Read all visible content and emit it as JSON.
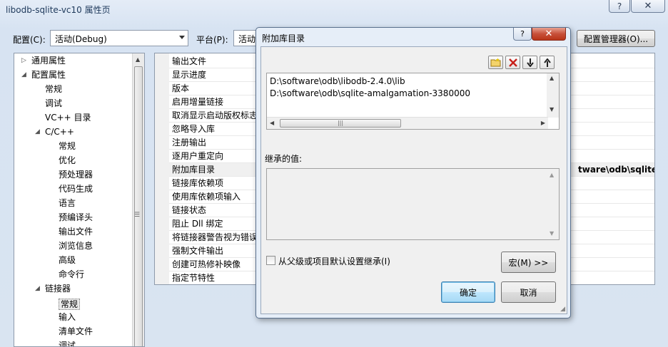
{
  "window": {
    "title": "libodb-sqlite-vc10 属性页",
    "help_label": "?",
    "close_label": "✕"
  },
  "toolbar": {
    "config_label": "配置(C):",
    "config_value": "活动(Debug)",
    "platform_label": "平台(P):",
    "platform_value": "活动",
    "config_manager_label": "配置管理器(O)..."
  },
  "tree": {
    "items": [
      {
        "label": "通用属性",
        "level": 0,
        "arrow": "▷"
      },
      {
        "label": "配置属性",
        "level": 0,
        "arrow": "◢"
      },
      {
        "label": "常规",
        "level": 1
      },
      {
        "label": "调试",
        "level": 1
      },
      {
        "label": "VC++ 目录",
        "level": 1
      },
      {
        "label": "C/C++",
        "level": 1,
        "arrow": "◢"
      },
      {
        "label": "常规",
        "level": 2
      },
      {
        "label": "优化",
        "level": 2
      },
      {
        "label": "预处理器",
        "level": 2
      },
      {
        "label": "代码生成",
        "level": 2
      },
      {
        "label": "语言",
        "level": 2
      },
      {
        "label": "预编译头",
        "level": 2
      },
      {
        "label": "输出文件",
        "level": 2
      },
      {
        "label": "浏览信息",
        "level": 2
      },
      {
        "label": "高级",
        "level": 2
      },
      {
        "label": "命令行",
        "level": 2
      },
      {
        "label": "链接器",
        "level": 1,
        "arrow": "◢"
      },
      {
        "label": "常规",
        "level": 2,
        "selected": true
      },
      {
        "label": "输入",
        "level": 2
      },
      {
        "label": "清单文件",
        "level": 2
      },
      {
        "label": "调试",
        "level": 2
      }
    ]
  },
  "properties": {
    "rows": [
      {
        "name": "输出文件"
      },
      {
        "name": "显示进度"
      },
      {
        "name": "版本"
      },
      {
        "name": "启用增量链接"
      },
      {
        "name": "取消显示启动版权标志"
      },
      {
        "name": "忽略导入库"
      },
      {
        "name": "注册输出"
      },
      {
        "name": "逐用户重定向"
      },
      {
        "name": "附加库目录",
        "value": "tware\\odb\\sqlite-a",
        "selected": true
      },
      {
        "name": "链接库依赖项"
      },
      {
        "name": "使用库依赖项输入"
      },
      {
        "name": "链接状态"
      },
      {
        "name": "阻止 Dll 绑定"
      },
      {
        "name": "将链接器警告视为错误"
      },
      {
        "name": "强制文件输出"
      },
      {
        "name": "创建可热修补映像"
      },
      {
        "name": "指定节特性"
      }
    ]
  },
  "dialog": {
    "title": "附加库目录",
    "help_label": "?",
    "close_label": "✕",
    "toolbar": {
      "new_folder_icon": "new-folder-icon",
      "delete_icon": "delete-icon",
      "move_down_icon": "move-down-icon",
      "move_up_icon": "move-up-icon"
    },
    "entries": [
      "D:\\software\\odb\\libodb-2.4.0\\lib",
      "D:\\software\\odb\\sqlite-amalgamation-3380000"
    ],
    "inherited_label": "继承的值:",
    "inherit_checkbox_label": "从父级或项目默认设置继承(I)",
    "inherit_checked": false,
    "macro_button_label": "宏(M) >>",
    "ok_label": "确定",
    "cancel_label": "取消",
    "hthumb_grip": "|||"
  }
}
